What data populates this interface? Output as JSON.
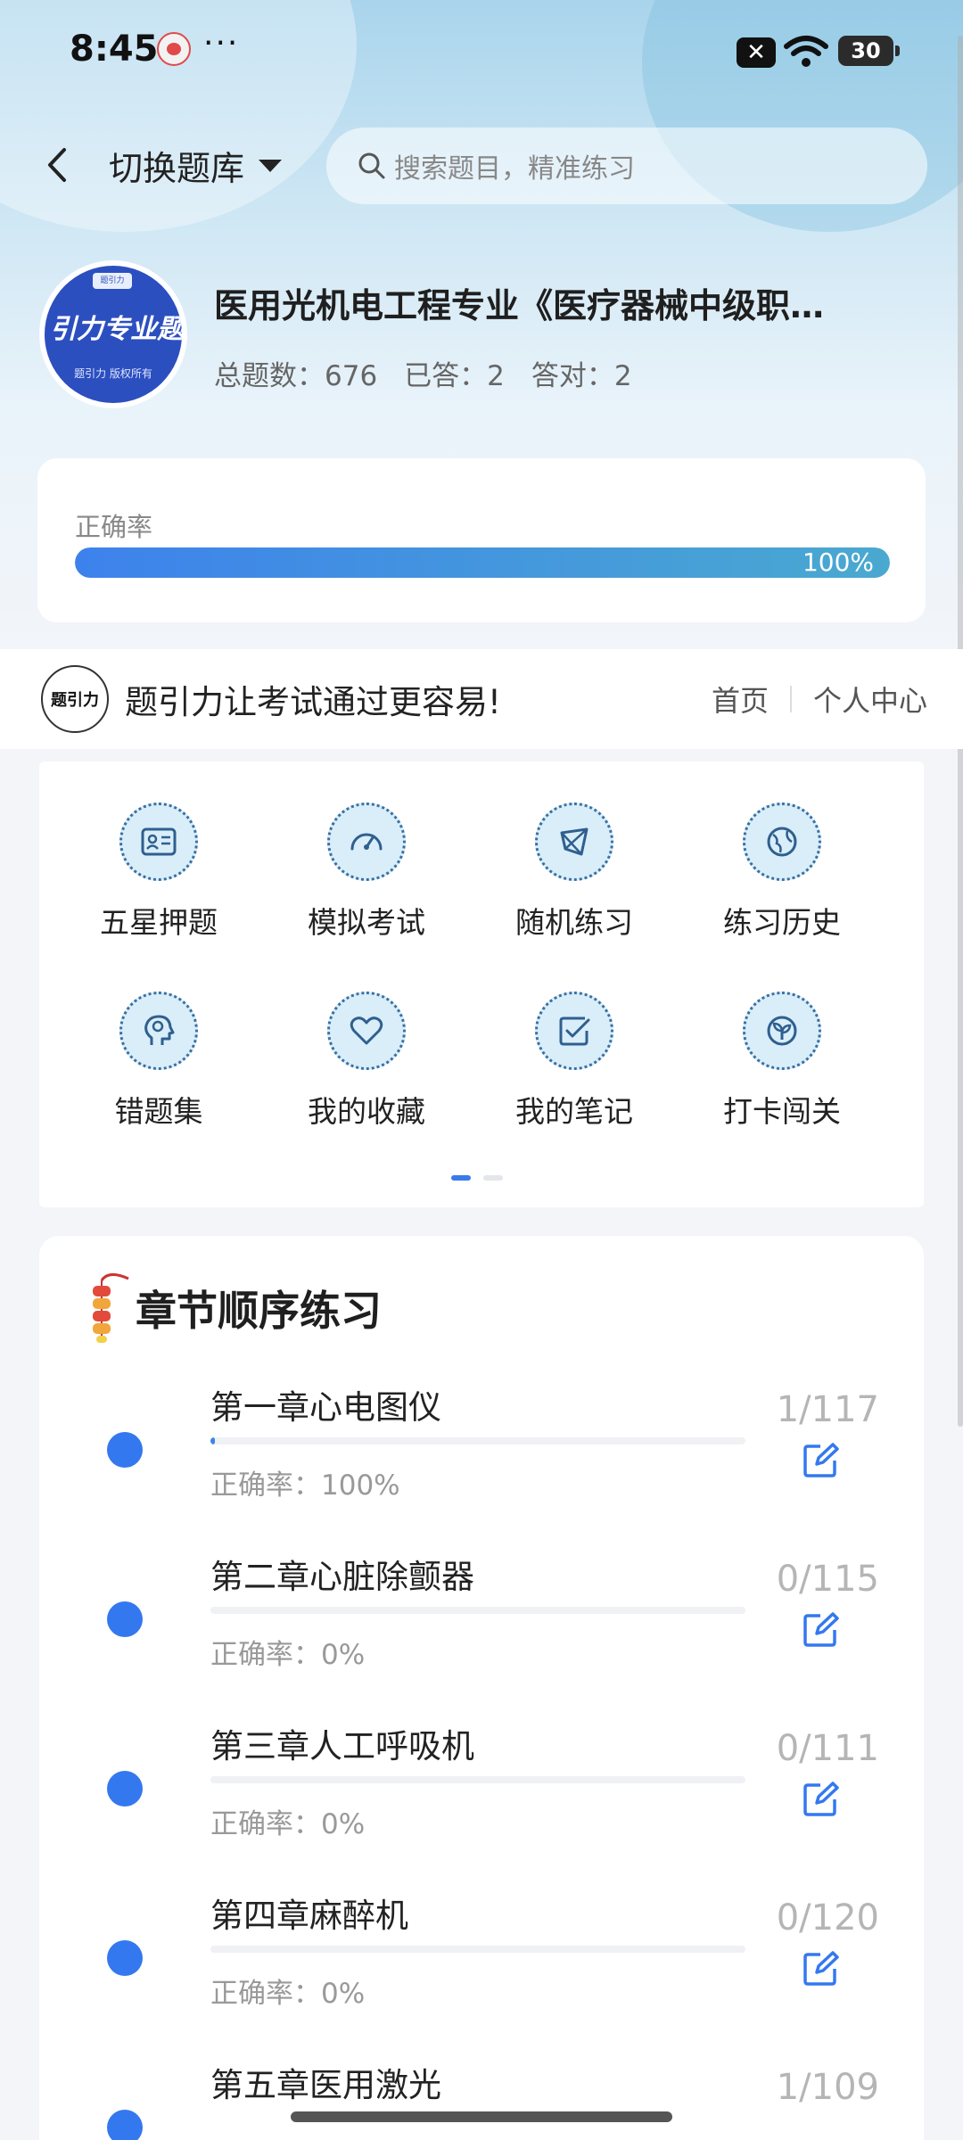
{
  "status_bar": {
    "time": "8:45",
    "more": "···",
    "battery": "30"
  },
  "header": {
    "switch_label": "切换题库",
    "search_placeholder": "搜索题目，精准练习"
  },
  "bank": {
    "logo_badge": "题引力",
    "logo_title": "引力专业题",
    "logo_sub": "题引力 版权所有",
    "title": "医用光机电工程专业《医疗器械中级职…",
    "stats": [
      {
        "label": "总题数：",
        "value": "676"
      },
      {
        "label": "已答：",
        "value": "2"
      },
      {
        "label": "答对：",
        "value": "2"
      }
    ]
  },
  "accuracy": {
    "label": "正确率",
    "value_text": "100%",
    "fraction": 1.0
  },
  "banner": {
    "logo_text": "题引力",
    "slogan": "题引力让考试通过更容易!",
    "links": [
      "首页",
      "个人中心"
    ]
  },
  "features": [
    {
      "label": "五星押题",
      "icon": "id-card-icon"
    },
    {
      "label": "模拟考试",
      "icon": "speedometer-icon"
    },
    {
      "label": "随机练习",
      "icon": "random-shape-icon"
    },
    {
      "label": "练习历史",
      "icon": "globe-icon"
    },
    {
      "label": "错题集",
      "icon": "head-icon"
    },
    {
      "label": "我的收藏",
      "icon": "heart-icon"
    },
    {
      "label": "我的笔记",
      "icon": "note-check-icon"
    },
    {
      "label": "打卡闯关",
      "icon": "sprout-icon"
    }
  ],
  "pager": {
    "pages": 2,
    "active": 0
  },
  "chapters": {
    "title": "章节顺序练习",
    "items": [
      {
        "name": "第一章心电图仪",
        "count": "1/117",
        "accuracy": "正确率：100%",
        "progress": 0.0085
      },
      {
        "name": "第二章心脏除颤器",
        "count": "0/115",
        "accuracy": "正确率：0%",
        "progress": 0
      },
      {
        "name": "第三章人工呼吸机",
        "count": "0/111",
        "accuracy": "正确率：0%",
        "progress": 0
      },
      {
        "name": "第四章麻醉机",
        "count": "0/120",
        "accuracy": "正确率：0%",
        "progress": 0
      },
      {
        "name": "第五章医用激光",
        "count": "1/109",
        "accuracy": "",
        "progress": 0.009
      }
    ]
  },
  "colors": {
    "accent": "#3478ef",
    "icon_bg": "#d9eef9",
    "icon_stroke": "#2f5f8f"
  }
}
